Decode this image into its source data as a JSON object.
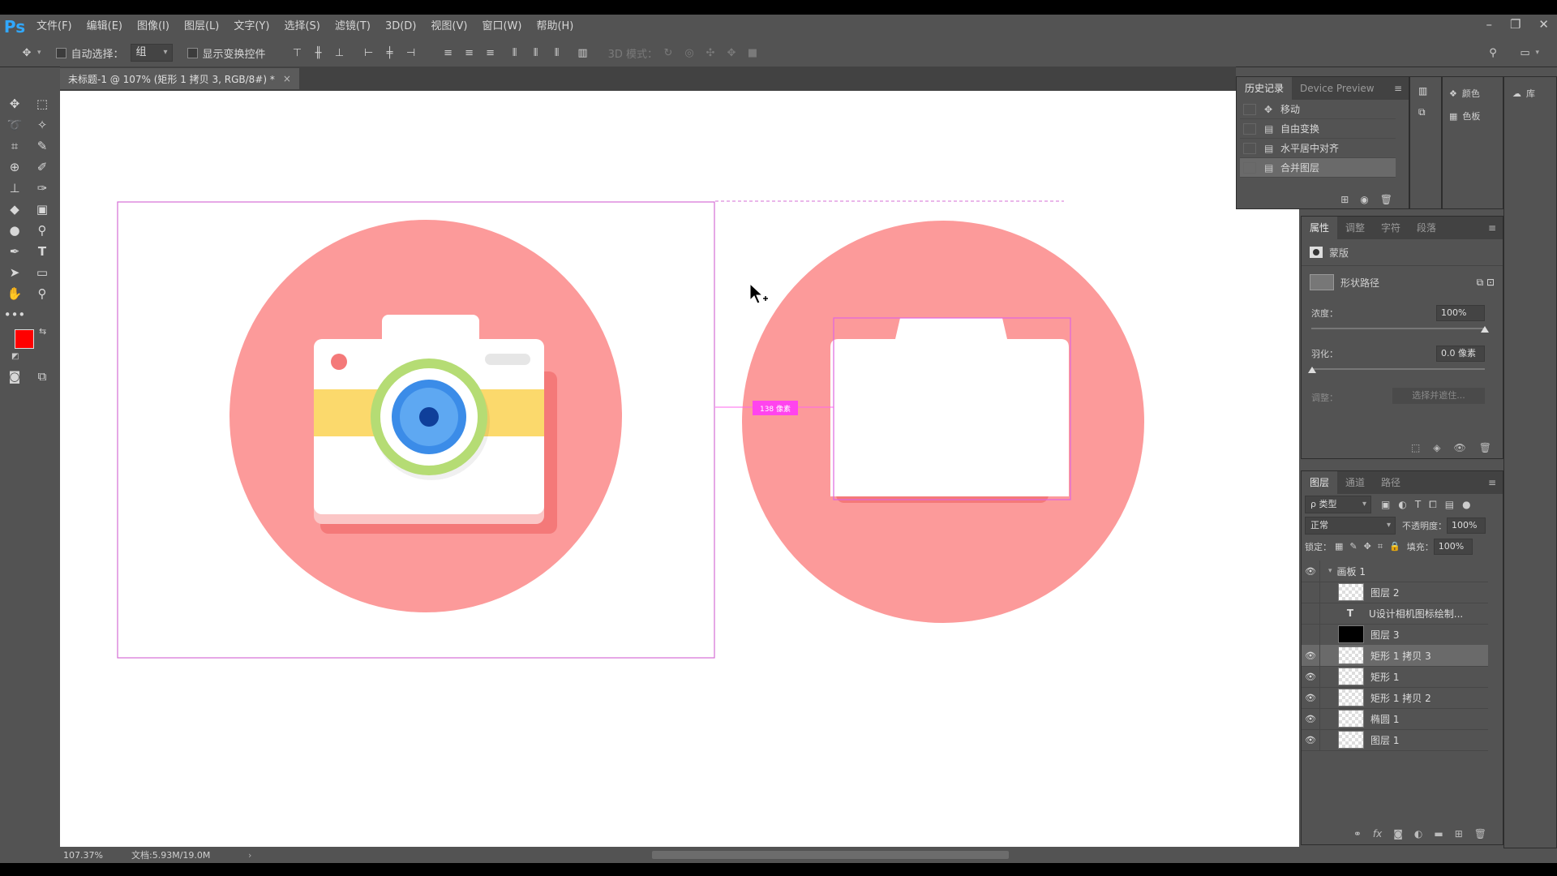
{
  "app": {
    "logo": "Ps"
  },
  "menu": [
    "文件(F)",
    "编辑(E)",
    "图像(I)",
    "图层(L)",
    "文字(Y)",
    "选择(S)",
    "滤镜(T)",
    "3D(D)",
    "视图(V)",
    "窗口(W)",
    "帮助(H)"
  ],
  "options": {
    "auto_select_label": "自动选择：",
    "auto_select_value": "组",
    "show_transform_label": "显示变换控件",
    "mode3d_label": "3D 模式："
  },
  "document": {
    "tab_title": "未标题-1 @ 107% (矩形 1 拷贝 3, RGB/8#) *",
    "close_glyph": "×",
    "distance_label": "138 像素"
  },
  "status": {
    "zoom": "107.37%",
    "doc_size": "文档:5.93M/19.0M"
  },
  "colors": {
    "foreground": "#ff0000",
    "background": "#000000",
    "accent_pink": "#ff66ee",
    "circle": "#fc9a9a"
  },
  "history": {
    "tabs": [
      "历史记录",
      "Device Preview"
    ],
    "items": [
      "移动",
      "自由变换",
      "水平居中对齐",
      "合并图层"
    ]
  },
  "mini_panels": {
    "color": "颜色",
    "swatches": "色板",
    "library": "库"
  },
  "properties": {
    "tabs": [
      "属性",
      "调整",
      "字符",
      "段落"
    ],
    "mask_label": "蒙版",
    "shape_path_label": "形状路径",
    "density_label": "浓度：",
    "density_value": "100%",
    "density_level": 1.0,
    "feather_label": "羽化：",
    "feather_value": "0.0 像素",
    "refine_label": "调整：",
    "select_mask_button": "选择并遮住..."
  },
  "layers": {
    "tabs": [
      "图层",
      "通道",
      "路径"
    ],
    "filter_label": "ρ 类型",
    "blend_mode": "正常",
    "opacity_label": "不透明度：",
    "opacity_value": "100%",
    "lock_label": "锁定：",
    "fill_label": "填充：",
    "fill_value": "100%",
    "items": [
      {
        "name": "画板 1",
        "visible": true,
        "type": "artboard"
      },
      {
        "name": "图层 2",
        "visible": false,
        "type": "pixel"
      },
      {
        "name": "U设计相机图标绘制...",
        "visible": false,
        "type": "text"
      },
      {
        "name": "图层 3",
        "visible": false,
        "type": "black"
      },
      {
        "name": "矩形 1 拷贝 3",
        "visible": true,
        "type": "shape",
        "selected": true
      },
      {
        "name": "矩形 1",
        "visible": true,
        "type": "shape"
      },
      {
        "name": "矩形 1 拷贝 2",
        "visible": true,
        "type": "shape"
      },
      {
        "name": "椭圆 1",
        "visible": true,
        "type": "shape"
      },
      {
        "name": "图层 1",
        "visible": true,
        "type": "pixel"
      }
    ]
  }
}
